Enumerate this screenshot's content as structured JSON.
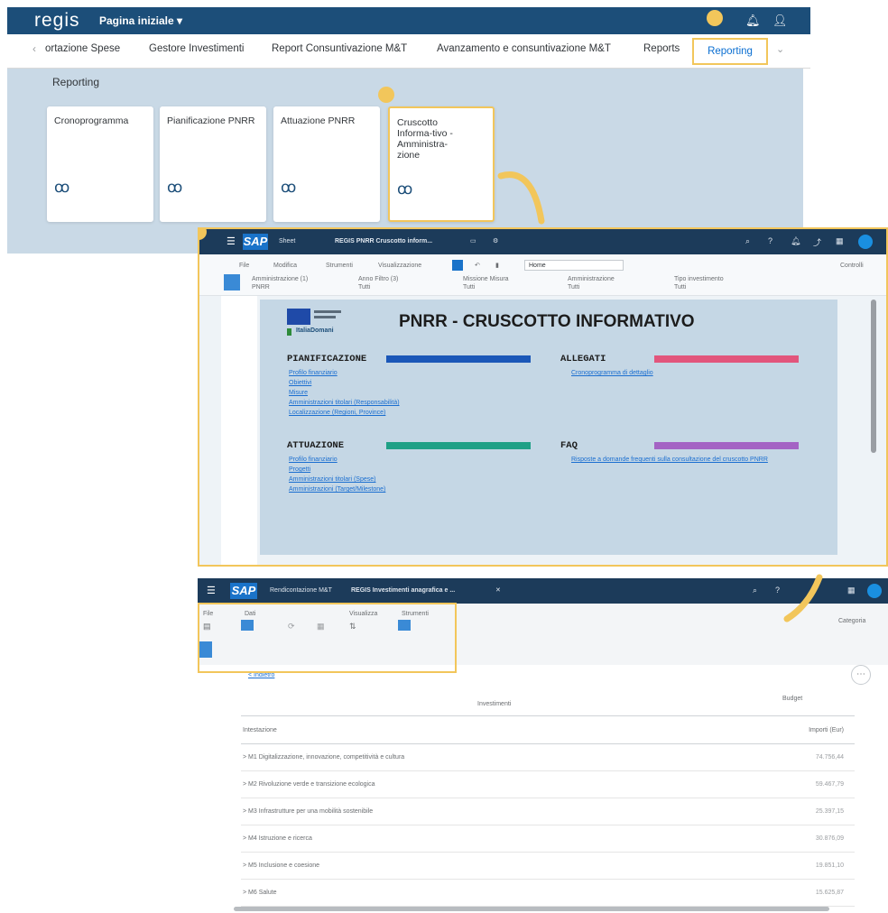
{
  "shell": {
    "logo": "regis",
    "home_menu": "Pagina iniziale ▾",
    "notification_icon": "bell-icon",
    "user_icon": "user-icon"
  },
  "tabs": {
    "items": [
      "ortazione Spese",
      "Gestore Investimenti",
      "Report Consuntivazione M&T",
      "Avanzamento e consuntivazione M&T",
      "Reports"
    ],
    "selected": "Reporting"
  },
  "reporting": {
    "title": "Reporting",
    "tiles": [
      {
        "title": "Cronoprogramma",
        "icon": "glasses-icon"
      },
      {
        "title": "Pianificazione PNRR",
        "icon": "glasses-icon"
      },
      {
        "title": "Attuazione PNRR",
        "icon": "glasses-icon"
      },
      {
        "title": "Cruscotto Informa-tivo - Amministra-zione",
        "icon": "glasses-icon"
      }
    ]
  },
  "window1": {
    "sap_logo": "SAP",
    "tab_label": "Sheet",
    "window_title": "REGIS PNRR Cruscotto inform...",
    "toolbar": [
      "File",
      "Modifica",
      "Strumenti",
      "Visualizzazione"
    ],
    "sheet_field": "Home",
    "right_label": "Controlli",
    "filters": [
      "Amministrazione (1)",
      "Anno Filtro (3)",
      "Missione Misura",
      "Amministrazione",
      "Tipo investimento"
    ],
    "filter_values": [
      "PNRR",
      "Tutti",
      "Tutti",
      "Tutti",
      "Tutti"
    ],
    "doc_title": "PNRR - CRUSCOTTO INFORMATIVO",
    "logo_text": "ItaliaDomani",
    "sections": [
      {
        "title": "PIANIFICAZIONE",
        "color": "#1b57b8",
        "links": [
          "Profilo finanziario",
          "Obiettivi",
          "Misure",
          "Amministrazioni titolari (Responsabilità)",
          "Localizzazione (Regioni, Province)"
        ]
      },
      {
        "title": "ALLEGATI",
        "color": "#e2557c",
        "links": [
          "Cronoprogramma di dettaglio"
        ]
      },
      {
        "title": "ATTUAZIONE",
        "color": "#1fa086",
        "links": [
          "Profilo finanziario",
          "Progetti",
          "Amministrazioni titolari (Spese)",
          "Amministrazioni (Target/Milestone)"
        ]
      },
      {
        "title": "FAQ",
        "color": "#a463c4",
        "links": [
          "Risposte a domande frequenti sulla consultazione del cruscotto PNRR"
        ]
      }
    ]
  },
  "window2": {
    "sap_logo": "SAP",
    "tab_label": "Rendicontazione M&T",
    "window_title": "REGIS Investimenti anagrafica e ...",
    "toolbar": [
      "File",
      "Dati",
      "Visualizza",
      "Strumenti"
    ],
    "right_label": "Categoria",
    "breadcrumb": "< Indietro",
    "column_header": "Investimenti",
    "column_header_right": "Budget",
    "group_header": "Intestazione",
    "group_value": "Importi (Eur)",
    "rows": [
      {
        "label": "> M1 Digitalizzazione, innovazione, competitività e cultura",
        "value": "74.756,44"
      },
      {
        "label": "> M2 Rivoluzione verde e transizione ecologica",
        "value": "59.467,79"
      },
      {
        "label": "> M3 Infrastrutture per una mobilità sostenibile",
        "value": "25.397,15"
      },
      {
        "label": "> M4 Istruzione e ricerca",
        "value": "30.876,09"
      },
      {
        "label": "> M5 Inclusione e coesione",
        "value": "19.851,10"
      },
      {
        "label": "> M6 Salute",
        "value": "15.625,87"
      }
    ]
  },
  "colors": {
    "shell": "#1c4e79",
    "highlight": "#f2c65b",
    "reporting_bg": "#c9d9e6",
    "sap_bar": "#1c3b5a"
  }
}
